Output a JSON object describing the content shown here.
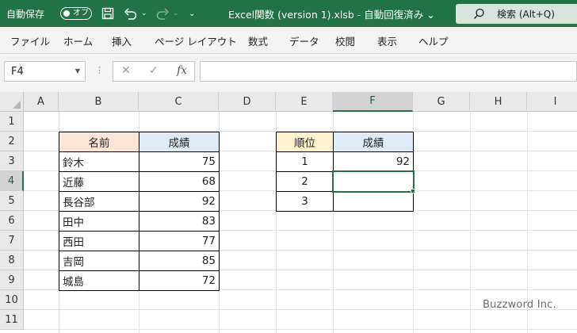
{
  "titlebar": {
    "autosave_label": "自動保存",
    "autosave_state": "オフ",
    "document_title": "Excel関数 (version 1).xlsb  -  自動回復済み  ⌄",
    "search_label": "検索 (Alt+Q)"
  },
  "ribbon": {
    "tabs": [
      "ファイル",
      "ホーム",
      "挿入",
      "ページ レイアウト",
      "数式",
      "データ",
      "校閲",
      "表示",
      "ヘルプ"
    ]
  },
  "formula_bar": {
    "name_box": "F4",
    "fx": "fx",
    "formula": ""
  },
  "grid": {
    "columns": [
      "A",
      "B",
      "C",
      "D",
      "E",
      "F",
      "G",
      "H",
      "I"
    ],
    "rows": [
      "1",
      "2",
      "3",
      "4",
      "5",
      "6",
      "7",
      "8",
      "9",
      "10",
      "11"
    ],
    "active_cell": "F4"
  },
  "table1": {
    "header_name": "名前",
    "header_score": "成績",
    "rows": [
      {
        "name": "鈴木",
        "score": "75"
      },
      {
        "name": "近藤",
        "score": "68"
      },
      {
        "name": "長谷部",
        "score": "92"
      },
      {
        "name": "田中",
        "score": "83"
      },
      {
        "name": "西田",
        "score": "77"
      },
      {
        "name": "吉岡",
        "score": "85"
      },
      {
        "name": "城島",
        "score": "72"
      }
    ]
  },
  "table2": {
    "header_rank": "順位",
    "header_score": "成績",
    "rows": [
      {
        "rank": "1",
        "score": "92"
      },
      {
        "rank": "2",
        "score": ""
      },
      {
        "rank": "3",
        "score": ""
      }
    ]
  },
  "watermark": "Buzzword Inc.",
  "colors": {
    "excel_green": "#217346",
    "header_pink": "#fce4d6",
    "header_blue": "#ddebf7",
    "header_yellow": "#fff2cc"
  }
}
